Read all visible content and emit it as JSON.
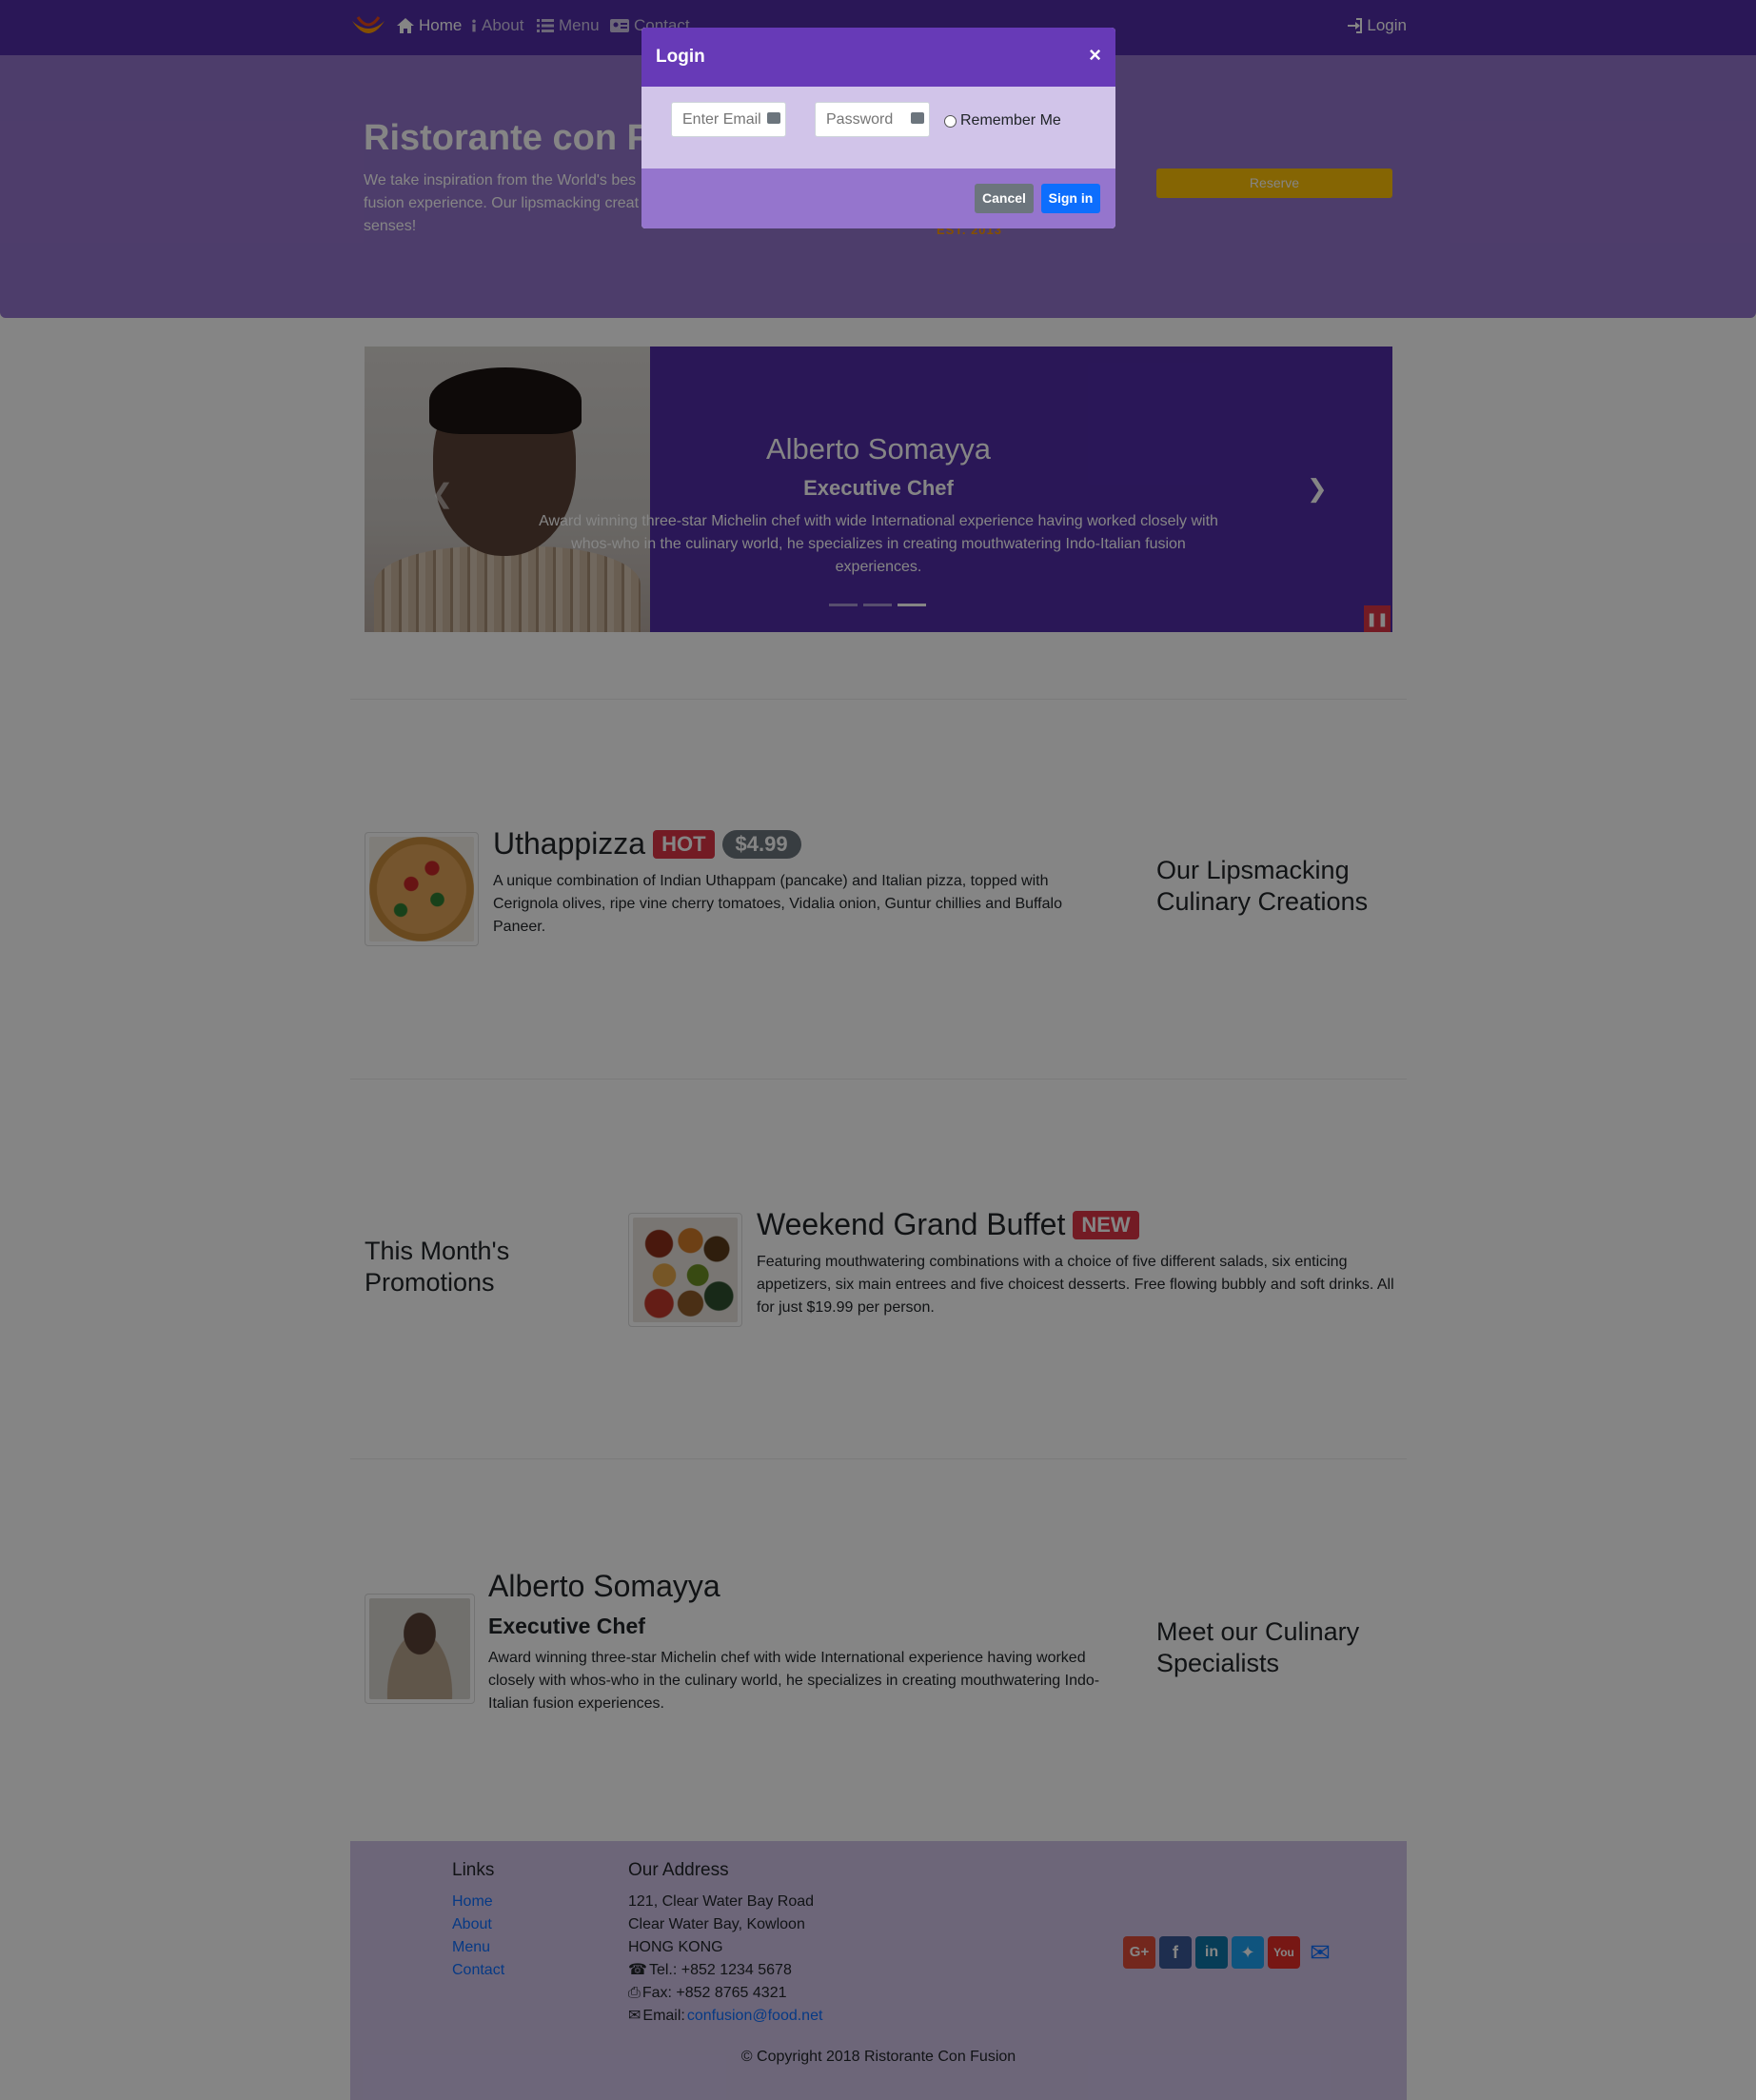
{
  "nav": {
    "items": [
      {
        "label": "Home"
      },
      {
        "label": "About"
      },
      {
        "label": "Menu"
      },
      {
        "label": "Contact"
      }
    ],
    "login_label": "Login"
  },
  "jumbotron": {
    "title": "Ristorante con Fu",
    "text": "We take inspiration from the World's bes fusion experience. Our lipsmacking creat senses!",
    "reserve_label": "Reserve",
    "logo_est": "EST. 2013"
  },
  "carousel": {
    "name": "Alberto Somayya",
    "role": "Executive Chef",
    "description": "Award winning three-star Michelin chef with wide International experience having worked closely with whos-who in the culinary world, he specializes in creating mouthwatering Indo-Italian fusion experiences.",
    "slide_count": 3,
    "active_index": 2,
    "pause_icon": "pause-icon"
  },
  "sections": {
    "dish": {
      "row_title": "Our Lipsmacking Culinary Creations",
      "name": "Uthappizza",
      "badge": "HOT",
      "price": "$4.99",
      "description": "A unique combination of Indian Uthappam (pancake) and Italian pizza, topped with Cerignola olives, ripe vine cherry tomatoes, Vidalia onion, Guntur chillies and Buffalo Paneer."
    },
    "promotion": {
      "row_title": "This Month's Promotions",
      "name": "Weekend Grand Buffet",
      "badge": "NEW",
      "description": "Featuring mouthwatering combinations with a choice of five different salads, six enticing appetizers, six main entrees and five choicest desserts. Free flowing bubbly and soft drinks. All for just $19.99 per person."
    },
    "leader": {
      "row_title": "Meet our Culinary Specialists",
      "name": "Alberto Somayya",
      "role": "Executive Chef",
      "description": "Award winning three-star Michelin chef with wide International experience having worked closely with whos-who in the culinary world, he specializes in creating mouthwatering Indo-Italian fusion experiences."
    }
  },
  "footer": {
    "links_title": "Links",
    "links": [
      "Home",
      "About",
      "Menu",
      "Contact"
    ],
    "address_title": "Our Address",
    "address_lines": [
      "121, Clear Water Bay Road",
      "Clear Water Bay, Kowloon",
      "HONG KONG"
    ],
    "tel": "Tel.: +852 1234 5678",
    "fax": "Fax: +852 8765 4321",
    "email_label": "Email: ",
    "email": "confusion@food.net",
    "social": [
      "google-plus-icon",
      "facebook-icon",
      "linkedin-icon",
      "twitter-icon",
      "youtube-icon",
      "envelope-icon"
    ],
    "copyright": "© Copyright 2018 Ristorante Con Fusion"
  },
  "modal": {
    "title": "Login",
    "close": "×",
    "email_placeholder": "Enter Email",
    "password_placeholder": "Password",
    "remember_label": "Remember Me",
    "cancel_label": "Cancel",
    "signin_label": "Sign in"
  },
  "colors": {
    "primary": "#512da8",
    "light": "#d1c4e9",
    "medium": "#9575cd",
    "accent": "#673ab7",
    "reserve": "#ffc107",
    "danger": "#dc3545"
  }
}
